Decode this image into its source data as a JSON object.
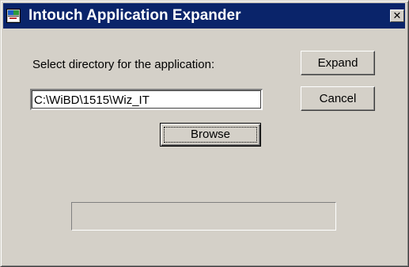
{
  "window": {
    "title": "Intouch Application Expander",
    "close_glyph": "✕",
    "icon": "intouch-app-icon"
  },
  "form": {
    "prompt_label": "Select directory for the application:",
    "directory_value": "C:\\WiBD\\1515\\Wiz_IT",
    "browse_label": "Browse"
  },
  "buttons": {
    "expand_label": "Expand",
    "cancel_label": "Cancel"
  },
  "progress": {
    "value": 0
  },
  "colors": {
    "titlebar": "#0a246a",
    "face": "#d4d0c8"
  }
}
